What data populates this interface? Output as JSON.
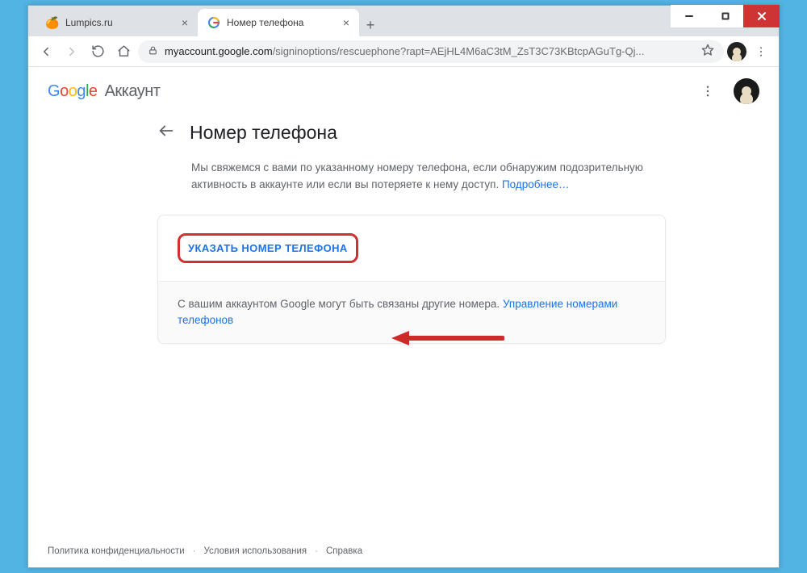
{
  "window": {
    "tabs": [
      {
        "title": "Lumpics.ru",
        "active": false
      },
      {
        "title": "Номер телефона",
        "active": true
      }
    ]
  },
  "toolbar": {
    "url_domain": "myaccount.google.com",
    "url_path": "/signinoptions/rescuephone?rapt=AEjHL4M6aC3tM_ZsT3C73KBtcpAGuTg-Qj..."
  },
  "header": {
    "logo_account": "Аккаунт"
  },
  "main": {
    "title": "Номер телефона",
    "description_pre": "Мы свяжемся с вами по указанному номеру телефона, если обнаружим подозрительную активность в аккаунте или если вы потеряете к нему доступ. ",
    "description_link": "Подробнее…",
    "cta_label": "УКАЗАТЬ НОМЕР ТЕЛЕФОНА",
    "info_pre": "С вашим аккаунтом Google могут быть связаны другие номера. ",
    "info_link": "Управление номерами телефонов"
  },
  "footer": {
    "privacy": "Политика конфиденциальности",
    "terms": "Условия использования",
    "help": "Справка"
  }
}
